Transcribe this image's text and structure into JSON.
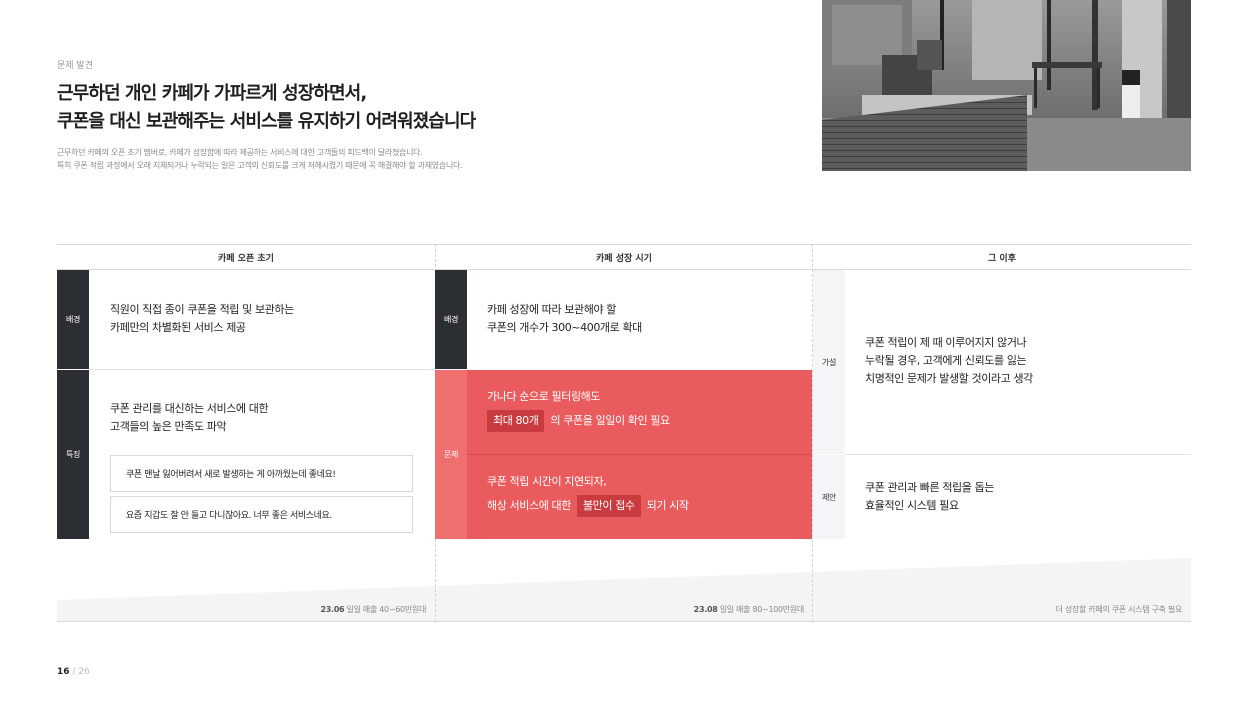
{
  "eyebrow": "문제 발견",
  "headline": {
    "line1": "근무하던 개인 카페가 가파르게 성장하면서,",
    "line2": "쿠폰을 대신 보관해주는 서비스를 유지하기 어려워졌습니다"
  },
  "description": {
    "line1": "근무하던 카페의 오픈 초기 멤버로, 카페가 성장함에 따라 제공하는 서비스에 대한 고객들의 피드백이 달라졌습니다.",
    "line2": "특히 쿠폰 적립 과정에서 오래 지체되거나 누락되는 일은 고객의 신뢰도를 크게 저해시켰기 때문에 꼭 해결해야 할 과제였습니다."
  },
  "columns": {
    "open": "카페 오픈 초기",
    "growth": "카페 성장 시기",
    "after": "그 이후"
  },
  "tags": {
    "background": "배경",
    "feature": "특징",
    "problem": "문제",
    "hypothesis": "가설",
    "proposal": "제안"
  },
  "open": {
    "background_l1": "직원이 직접 종이 쿠폰을 적립 및 보관하는",
    "background_l2": "카페만의 차별화된 서비스 제공",
    "feature_l1": "쿠폰 관리를 대신하는 서비스에 대한",
    "feature_l2": "고객들의 높은 만족도 파악",
    "quote1": "쿠폰 맨날 잃어버려서 새로 발생하는 게 아까웠는데 좋네요!",
    "quote2": "요즘 지갑도 잘 안 들고 다니잖아요. 너무 좋은 서비스네요."
  },
  "growth": {
    "background_l1": "카페 성장에 따라 보관해야 할",
    "background_l2": "쿠폰의 개수가 300~400개로 확대",
    "problem1_l1": "가나다 순으로 필터링해도",
    "problem1_hl": "최대 80개",
    "problem1_rest": "의 쿠폰을 일일이 확인 필요",
    "problem2_l1": "쿠폰 적립 시간이 지연되자,",
    "problem2_pre": "해상 서비스에 대한",
    "problem2_hl": "불만이 접수",
    "problem2_rest": "되기 시작"
  },
  "after": {
    "hypothesis_l1": "쿠폰 적립이 제 때 이루어지지 않거나",
    "hypothesis_l2": "누락될 경우, 고객에게 신뢰도를 잃는",
    "hypothesis_l3": "치명적인 문제가 발생할 것이라고 생각",
    "proposal_l1": "쿠폰 관리과 빠른 적립을 돕는",
    "proposal_l2": "효율적인 시스템 필요"
  },
  "footer": {
    "open_date": "23.06",
    "open_sales": "일일 매출 40~60만원대",
    "growth_date": "23.08",
    "growth_sales": "일일 매출 80~100만원대",
    "after_note": "더 성장할 카페의 쿠폰 시스템 구축 필요"
  },
  "pager": {
    "current": "16",
    "total": "26"
  },
  "colors": {
    "dark_tag": "#2b2e33",
    "problem_red": "#ea5b5e",
    "highlight_red": "#c93b3f",
    "problem_tag": "#f07070",
    "footer_wedge": "#f3f4f5"
  }
}
